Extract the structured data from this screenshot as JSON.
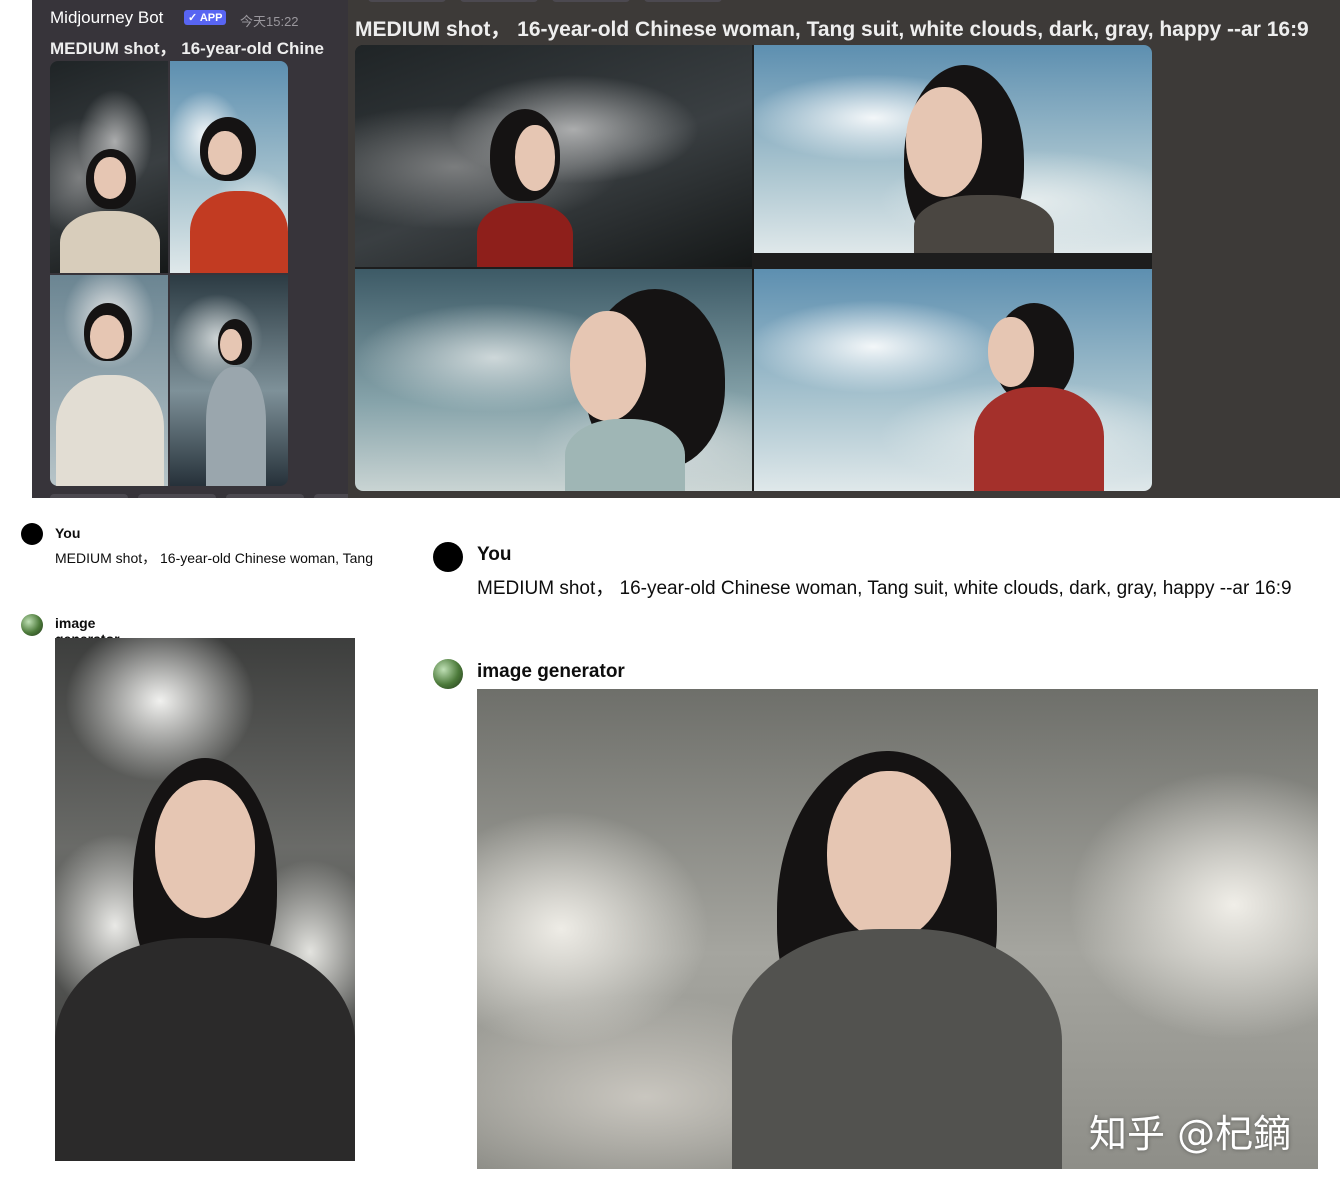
{
  "midjourney": {
    "bot_name": "Midjourney Bot",
    "badge": "✓ APP",
    "timestamp": "今天15:22",
    "prompt_truncated": "MEDIUM shot， 16-year-old Chine",
    "prompt_full": "MEDIUM shot， 16-year-old Chinese woman, Tang suit, white clouds, dark, gray, happy --ar 16:9"
  },
  "chat_small": {
    "user_name": "You",
    "user_message": "MEDIUM shot， 16-year-old Chinese woman, Tang",
    "gen_name": "image generator"
  },
  "chat_large": {
    "user_name": "You",
    "user_message": "MEDIUM shot， 16-year-old Chinese woman, Tang suit, white clouds, dark, gray, happy --ar 16:9",
    "gen_name": "image generator"
  },
  "watermark": "知乎 @杞鏑",
  "colors": {
    "discord_bg": "#37343a",
    "discord_bg_2": "#3d3a38",
    "badge_blue": "#5865f2"
  }
}
